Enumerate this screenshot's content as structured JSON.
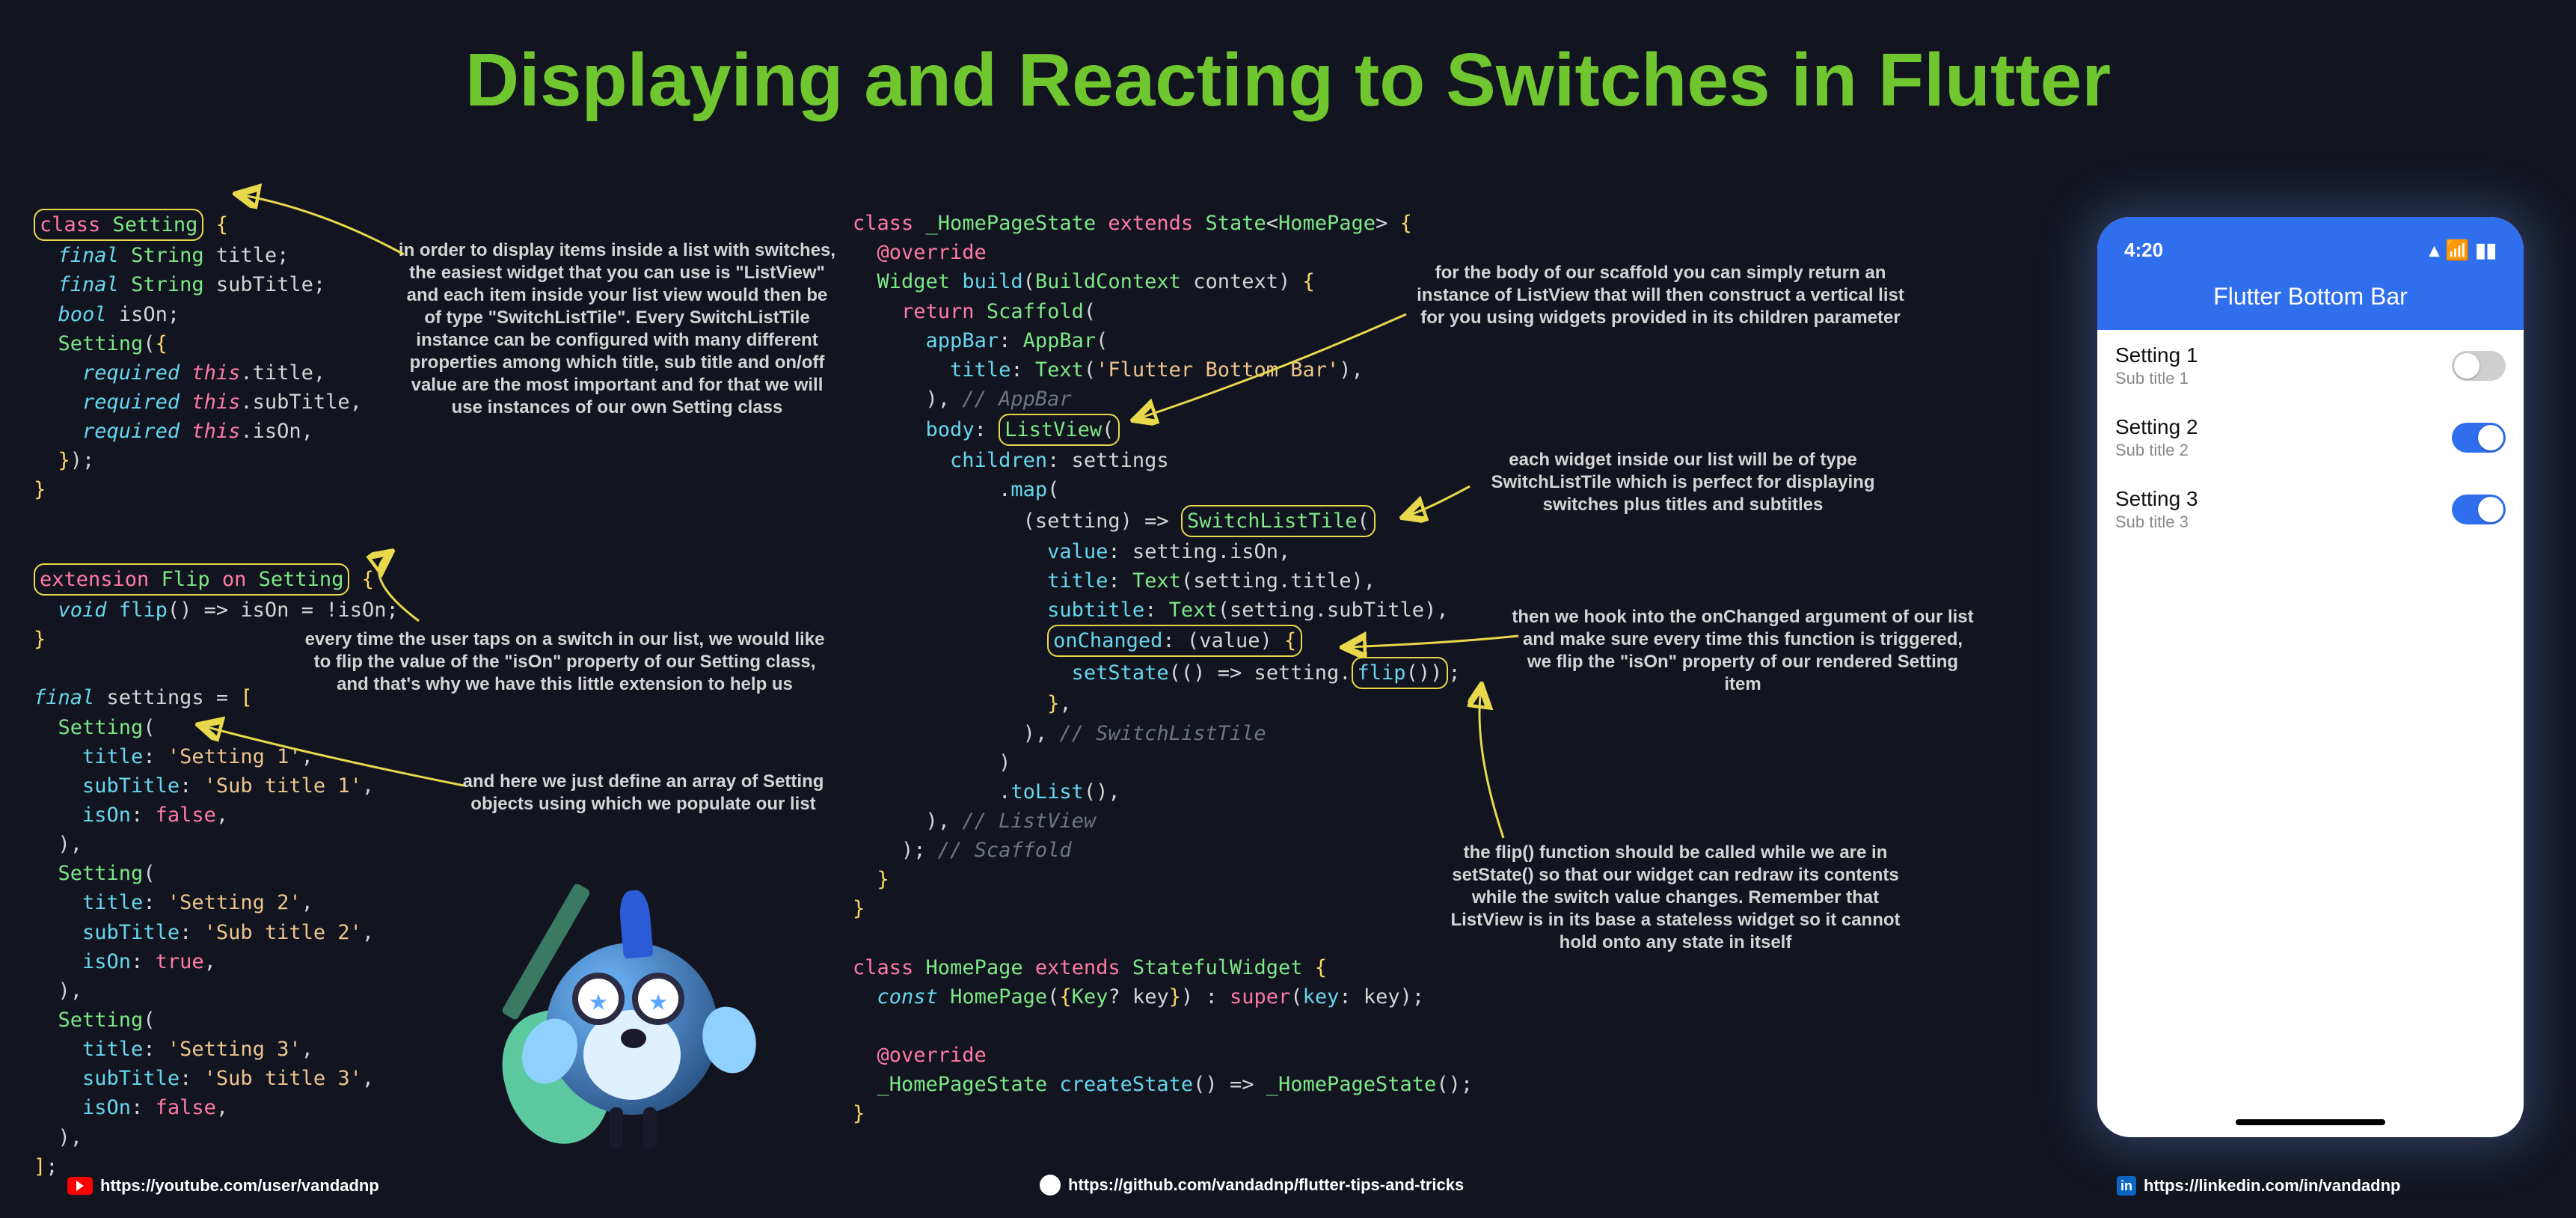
{
  "title": "Displaying and Reacting to Switches in Flutter",
  "annotations": {
    "listview_intro": "in order to display items inside a list with switches, the easiest widget that you can use is \"ListView\" and each item inside your list view would then be of type \"SwitchListTile\". Every SwitchListTile instance can be configured with many different properties among which title, sub title and on/off value are the most important and for that we will use instances of our own Setting class",
    "flip_ext": "every time the user taps on a switch in our list, we would like to flip the value of the \"isOn\" property of our Setting class, and that's why we have this little extension to help us",
    "settings_array": "and here we just define an array of Setting objects using which we populate our list",
    "body_listview": "for the body of our scaffold you can simply return an instance of ListView that will then construct a vertical list for you using widgets provided in its children parameter",
    "switchlisttile": "each widget inside our list will be of type SwitchListTile which is perfect for displaying switches plus titles and subtitles",
    "onchanged": "then we hook into the onChanged argument of our list and make sure every time this function is triggered, we flip the \"isOn\" property of our rendered Setting item",
    "flip_setstate": "the flip() function should be called while we are in setState() so that our widget can redraw its contents while the switch value changes. Remember that ListView is in its base a stateless widget so it cannot hold onto any state in itself"
  },
  "chart_data": {
    "type": "table",
    "code_left": {
      "class_setting": [
        "class Setting {",
        "  final String title;",
        "  final String subTitle;",
        "  bool isOn;",
        "  Setting({",
        "    required this.title,",
        "    required this.subTitle,",
        "    required this.isOn,",
        "  });",
        "}"
      ],
      "extension_flip": [
        "extension Flip on Setting {",
        "  void flip() => isOn = !isOn;",
        "}"
      ],
      "settings_list": [
        "final settings = [",
        "  Setting(",
        "    title: 'Setting 1',",
        "    subTitle: 'Sub title 1',",
        "    isOn: false,",
        "  ),",
        "  Setting(",
        "    title: 'Setting 2',",
        "    subTitle: 'Sub title 2',",
        "    isOn: true,",
        "  ),",
        "  Setting(",
        "    title: 'Setting 3',",
        "    subTitle: 'Sub title 3',",
        "    isOn: false,",
        "  ),",
        "];"
      ]
    },
    "code_right": {
      "home_page_state": [
        "class _HomePageState extends State<HomePage> {",
        "  @override",
        "  Widget build(BuildContext context) {",
        "    return Scaffold(",
        "      appBar: AppBar(",
        "        title: Text('Flutter Bottom Bar'),",
        "      ), // AppBar",
        "      body: ListView(",
        "        children: settings",
        "            .map(",
        "              (setting) => SwitchListTile(",
        "                value: setting.isOn,",
        "                title: Text(setting.title),",
        "                subtitle: Text(setting.subTitle),",
        "                onChanged: (value) {",
        "                  setState(() => setting.flip());",
        "                },",
        "              ), // SwitchListTile",
        "            )",
        "            .toList(),",
        "      ), // ListView",
        "    ); // Scaffold",
        "  }",
        "}"
      ],
      "home_page": [
        "class HomePage extends StatefulWidget {",
        "  const HomePage({Key? key}) : super(key: key);",
        "",
        "  @override",
        "  _HomePageState createState() => _HomePageState();",
        "}"
      ]
    },
    "circled_tokens": [
      "class Setting",
      "extension Flip on Setting",
      "ListView(",
      "SwitchListTile(",
      "onChanged: (value) {",
      "flip())"
    ]
  },
  "phone": {
    "time": "4:20",
    "app_title": "Flutter Bottom Bar",
    "rows": [
      {
        "title": "Setting 1",
        "sub": "Sub title 1",
        "on": false
      },
      {
        "title": "Setting 2",
        "sub": "Sub title 2",
        "on": true
      },
      {
        "title": "Setting 3",
        "sub": "Sub title 3",
        "on": true
      }
    ]
  },
  "links": {
    "youtube": "https://youtube.com/user/vandadnp",
    "github": "https://github.com/vandadnp/flutter-tips-and-tricks",
    "linkedin": "https://linkedin.com/in/vandadnp"
  }
}
